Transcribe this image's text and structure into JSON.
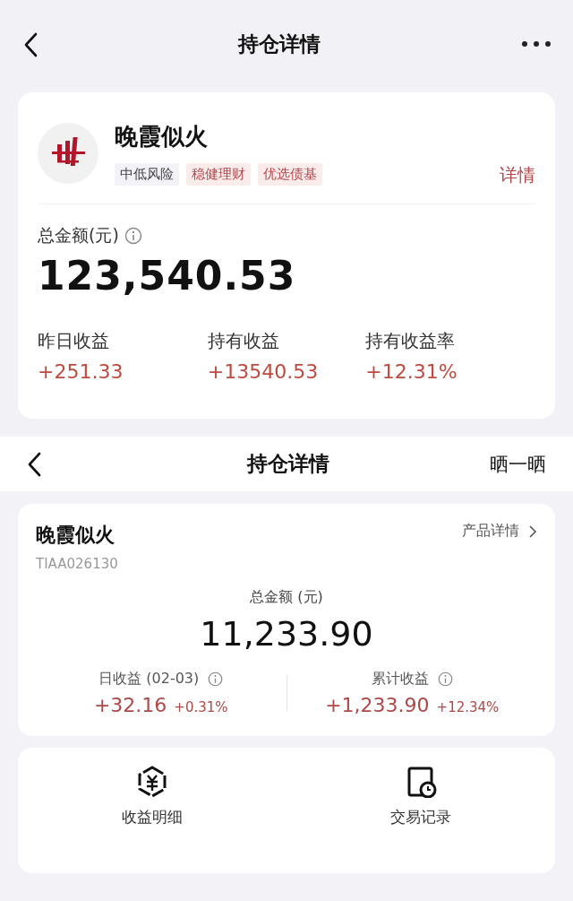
{
  "screens": [
    {
      "nav": {
        "title": "持仓详情"
      },
      "product": {
        "name": "晚霞似火",
        "tags": [
          {
            "label": "中低风险",
            "kind": "risk"
          },
          {
            "label": "稳健理财",
            "kind": "feature"
          },
          {
            "label": "优选债基",
            "kind": "feature"
          }
        ],
        "detail_link": "详情"
      },
      "total": {
        "label": "总金额(元)",
        "value": "123,540.53"
      },
      "stats": [
        {
          "label": "昨日收益",
          "value": "+251.33"
        },
        {
          "label": "持有收益",
          "value": "+13540.53"
        },
        {
          "label": "持有收益率",
          "value": "+12.31%"
        }
      ]
    },
    {
      "nav": {
        "title": "持仓详情",
        "action": "晒一晒"
      },
      "product": {
        "name": "晚霞似火",
        "code": "TIAA026130",
        "detail_link": "产品详情"
      },
      "total": {
        "label": "总金额 (元)",
        "value": "11,233.90"
      },
      "stats": [
        {
          "label": "日收益 (02-03)",
          "value": "+32.16",
          "percent": "+0.31%"
        },
        {
          "label": "累计收益",
          "value": "+1,233.90",
          "percent": "+12.34%"
        }
      ],
      "actions": [
        {
          "label": "收益明细",
          "kind": "income"
        },
        {
          "label": "交易记录",
          "kind": "records"
        }
      ]
    }
  ]
}
